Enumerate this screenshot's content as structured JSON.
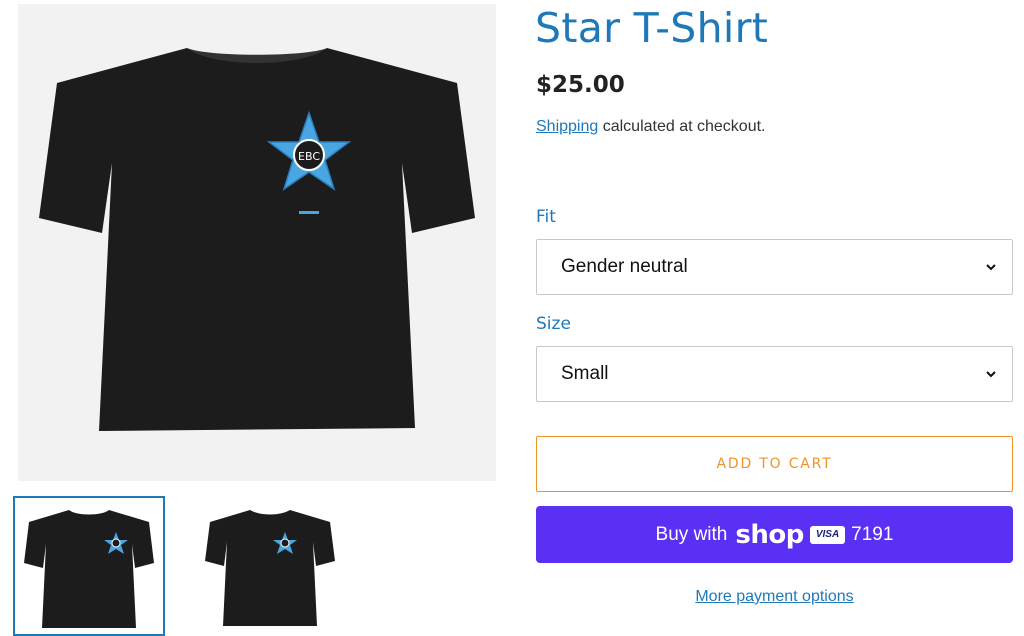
{
  "product": {
    "title": "Star T-Shirt",
    "price": "$25.00",
    "shipping_link": "Shipping",
    "shipping_rest": " calculated at checkout."
  },
  "options": {
    "fit_label": "Fit",
    "fit_value": "Gender neutral",
    "size_label": "Size",
    "size_value": "Small"
  },
  "actions": {
    "add_to_cart": "ADD TO CART",
    "buy_with": "Buy with",
    "shop_word": "shop",
    "card_brand": "VISA",
    "card_last4": "7191",
    "more_payment": "More payment options"
  },
  "colors": {
    "accent": "#1f79b8",
    "add_to_cart": "#f09326",
    "shop_pay": "#5a31f4"
  },
  "icons": [
    "chevron-down-icon",
    "star-logo-icon"
  ]
}
